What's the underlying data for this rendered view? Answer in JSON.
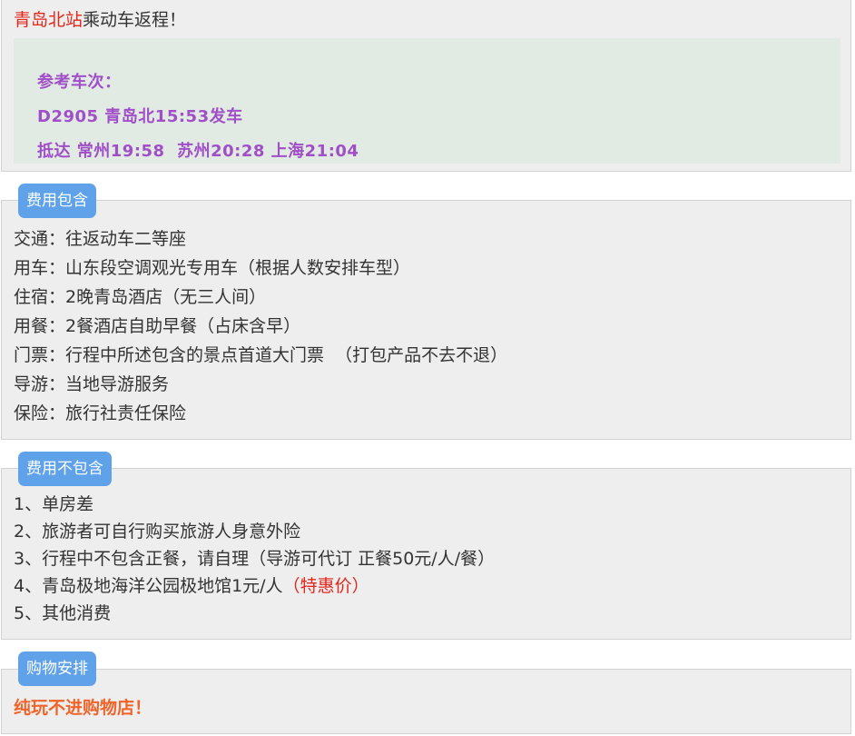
{
  "return": {
    "station": "青岛北站",
    "rest": "乘动车返程！"
  },
  "reference": {
    "title": "参考车次：",
    "train": "D2905 青岛北15:53发车",
    "arrival": "抵达 常州19:58  苏州20:28 上海21:04"
  },
  "included": {
    "label": "费用包含",
    "items": [
      "交通：往返动车二等座",
      "用车：山东段空调观光专用车（根据人数安排车型）",
      "住宿：2晚青岛酒店（无三人间）",
      "用餐：2餐酒店自助早餐（占床含早）",
      "门票：行程中所述包含的景点首道大门票  （打包产品不去不退）",
      "导游：当地导游服务",
      "保险：旅行社责任保险"
    ]
  },
  "excluded": {
    "label": "费用不包含",
    "items": [
      "1、单房差",
      "2、旅游者可自行购买旅游人身意外险",
      "3、行程中不包含正餐，请自理（导游可代订 正餐50元/人/餐）",
      "4、青岛极地海洋公园极地馆1元/人",
      "5、其他消费"
    ],
    "special_note": "（特惠价）"
  },
  "shopping": {
    "label": "购物安排",
    "text": "纯玩不进购物店！"
  },
  "colors": {
    "station": "#e2271c",
    "reference_text": "#a14fc8",
    "reference_bg": "#e1ebe3",
    "badge": "#5fa2ea",
    "shopping_text": "#f0642a"
  }
}
